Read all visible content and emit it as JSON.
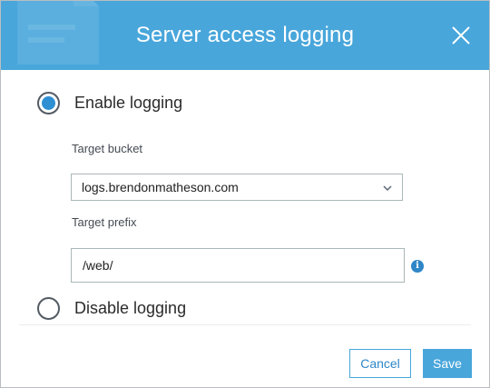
{
  "dialog": {
    "title": "Server access logging",
    "close_icon": "close-icon",
    "header_icon": "document-icon"
  },
  "options": {
    "enable_label": "Enable logging",
    "enable_selected": true,
    "disable_label": "Disable logging",
    "disable_selected": false
  },
  "target_bucket": {
    "label": "Target bucket",
    "value": "logs.brendonmatheson.com",
    "icon": "chevron-down-icon"
  },
  "target_prefix": {
    "label": "Target prefix",
    "value": "/web/",
    "info_icon": "info-icon",
    "info_glyph": "i"
  },
  "buttons": {
    "cancel_label": "Cancel",
    "save_label": "Save"
  },
  "colors": {
    "header": "#48a6db",
    "radio_selected": "#2e8fd3",
    "primary": "#48a6db"
  }
}
